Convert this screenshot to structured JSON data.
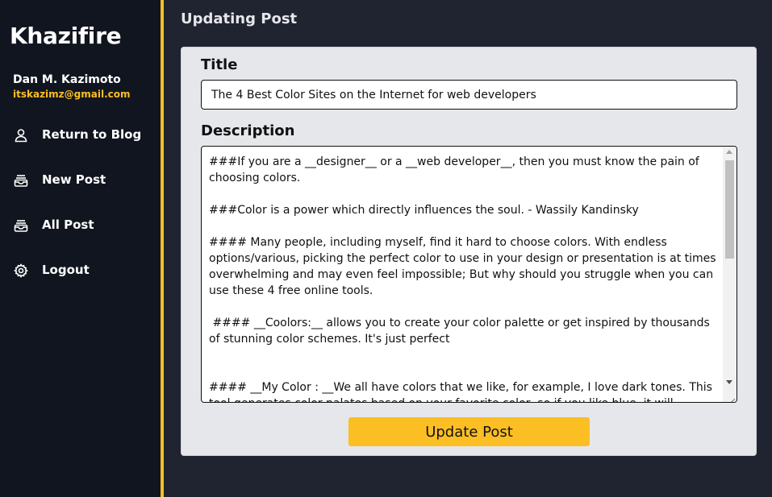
{
  "sidebar": {
    "brand": "Khazifire",
    "user": {
      "name": "Dan M. Kazimoto",
      "email": "itskazimz@gmail.com"
    },
    "items": [
      {
        "label": "Return to Blog",
        "icon": "user-icon"
      },
      {
        "label": "New Post",
        "icon": "inbox-icon"
      },
      {
        "label": "All Post",
        "icon": "inbox-icon"
      },
      {
        "label": "Logout",
        "icon": "gear-icon"
      }
    ]
  },
  "main": {
    "page_title": "Updating Post",
    "form": {
      "title_label": "Title",
      "title_value": "The 4 Best Color Sites on the Internet for web developers",
      "description_label": "Description",
      "description_value": "###If you are a __designer__ or a __web developer__, then you must know the pain of choosing colors.\n\n###Color is a power which directly influences the soul. - Wassily Kandinsky\n\n#### Many people, including myself, find it hard to choose colors. With endless options/various, picking the perfect color to use in your design or presentation is at times overwhelming and may even feel impossible; But why should you struggle when you can use these 4 free online tools.\n\n #### __Coolors:__ allows you to create your color palette or get inspired by thousands of stunning color schemes. It's just perfect\n\n\n#### __My Color : __We all have colors that we like, for example, I love dark tones. This tool generates color palates based on your favorite color, so if you like blue, it will",
      "submit_label": "Update Post"
    }
  },
  "colors": {
    "accent": "#fbbf24",
    "sidebar_bg": "#11151f",
    "main_bg": "#202330",
    "card_bg": "#e5e7eb"
  }
}
